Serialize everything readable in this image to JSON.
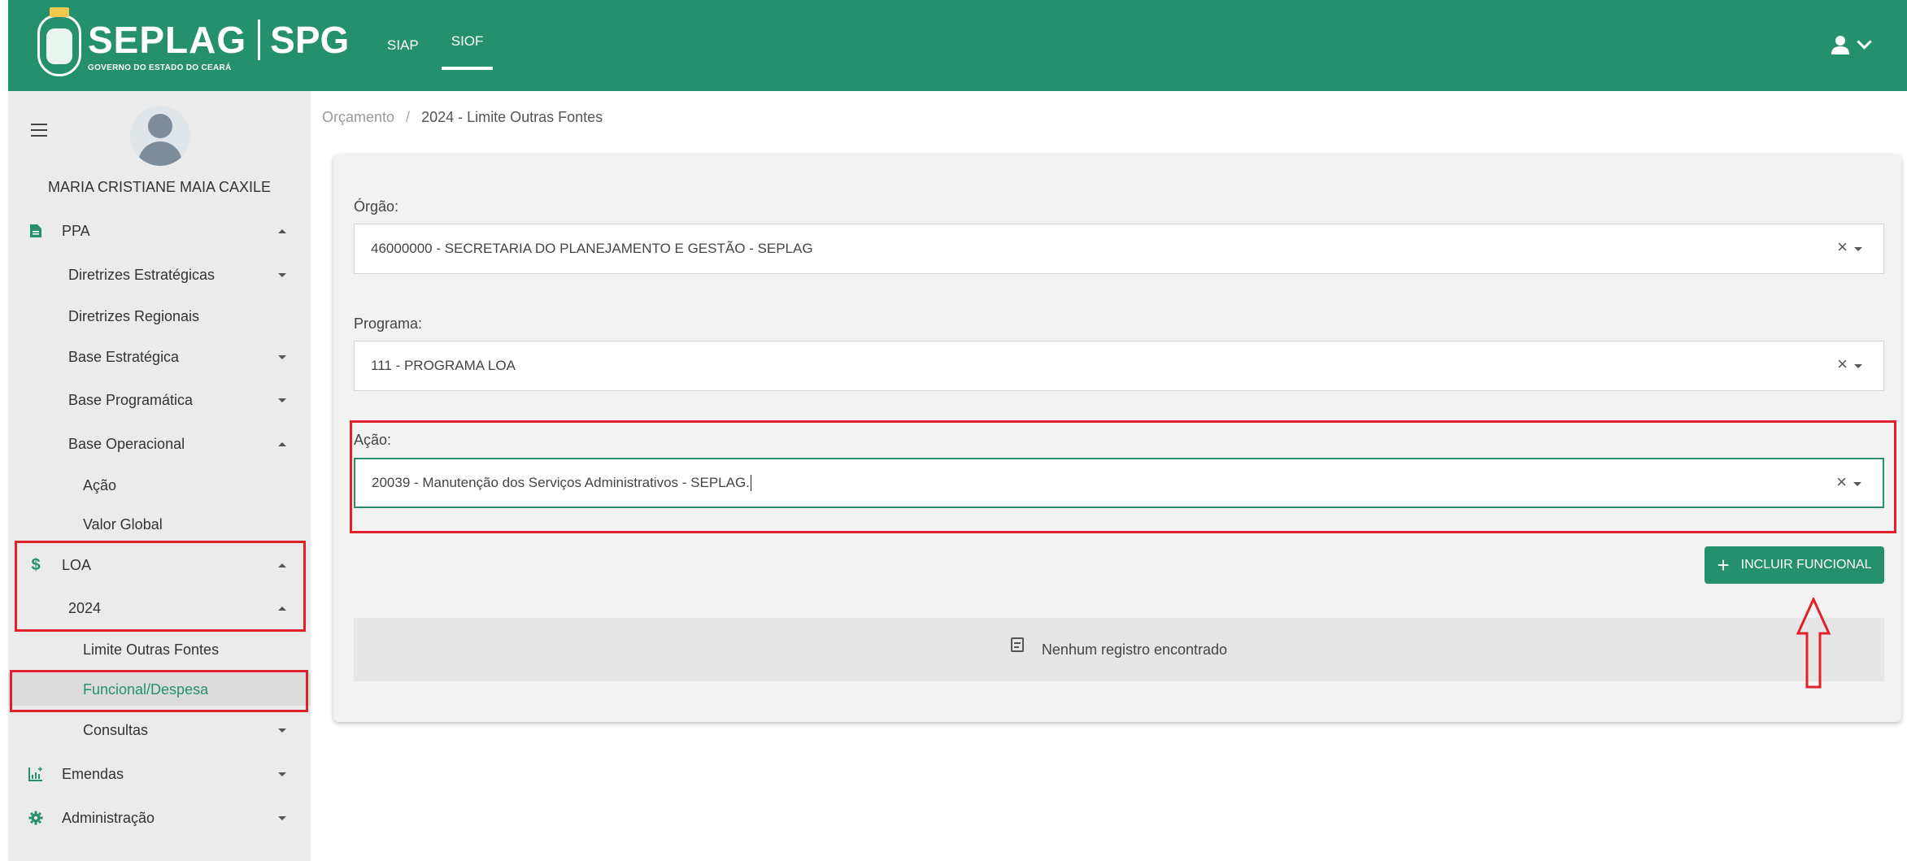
{
  "header": {
    "logo": {
      "title": "SEPLAG",
      "system": "SPG",
      "subtitle": "GOVERNO DO ESTADO DO CEARÁ"
    },
    "tabs": [
      {
        "label": "SIAP",
        "active": false
      },
      {
        "label": "SIOF",
        "active": true
      }
    ],
    "user_icon": "user-icon"
  },
  "sidebar": {
    "user_name": "MARIA CRISTIANE MAIA CAXILE",
    "items": [
      {
        "label": "PPA",
        "icon": "document-icon",
        "level": 0,
        "expanded": true
      },
      {
        "label": "Diretrizes Estratégicas",
        "level": 1,
        "expanded": false
      },
      {
        "label": "Diretrizes Regionais",
        "level": 1
      },
      {
        "label": "Base Estratégica",
        "level": 1,
        "expanded": false
      },
      {
        "label": "Base Programática",
        "level": 1,
        "expanded": false
      },
      {
        "label": "Base Operacional",
        "level": 1,
        "expanded": true
      },
      {
        "label": "Ação",
        "level": 2
      },
      {
        "label": "Valor Global",
        "level": 2
      },
      {
        "label": "LOA",
        "icon": "dollar-icon",
        "level": 0,
        "expanded": true
      },
      {
        "label": "2024",
        "level": 1,
        "expanded": true
      },
      {
        "label": "Limite Outras Fontes",
        "level": 2
      },
      {
        "label": "Funcional/Despesa",
        "level": 2,
        "active": true
      },
      {
        "label": "Consultas",
        "level": 2,
        "expanded": false
      },
      {
        "label": "Emendas",
        "icon": "chart-icon",
        "level": 0,
        "expanded": false
      },
      {
        "label": "Administração",
        "icon": "gear-icon",
        "level": 0,
        "expanded": false
      }
    ]
  },
  "breadcrumb": {
    "parent": "Orçamento",
    "separator": "/",
    "current": "2024 - Limite Outras Fontes"
  },
  "form": {
    "orgao": {
      "label": "Órgão:",
      "value": "46000000 - SECRETARIA DO PLANEJAMENTO E GESTÃO - SEPLAG"
    },
    "programa": {
      "label": "Programa:",
      "value": "111 - PROGRAMA LOA"
    },
    "acao": {
      "label": "Ação:",
      "value": "20039 - Manutenção dos Serviços Administrativos - SEPLAG."
    },
    "clear_glyph": "×",
    "add_button": "INCLUIR FUNCIONAL",
    "add_glyph": "+"
  },
  "results": {
    "empty_message": "Nenhum registro encontrado"
  },
  "colors": {
    "brand": "#25906d",
    "highlight": "#e0202a"
  }
}
